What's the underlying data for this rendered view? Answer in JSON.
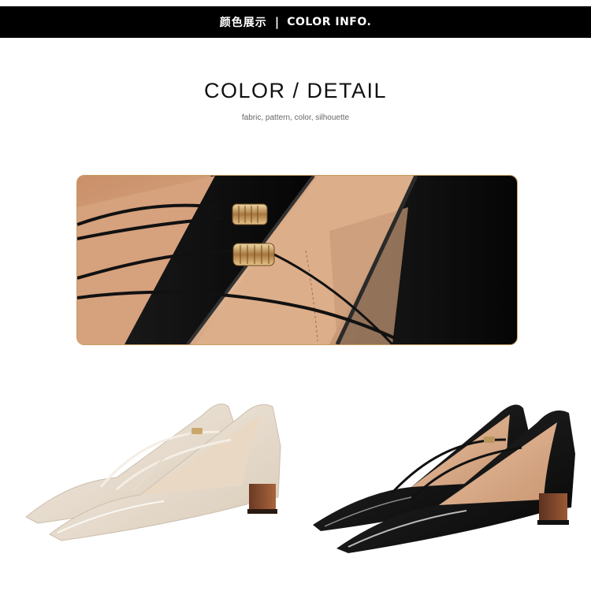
{
  "header": {
    "cn_label": "颜色展示",
    "separator": "|",
    "en_label": "COLOR INFO."
  },
  "section": {
    "title": "COLOR / DETAIL",
    "subtitle": "fabric, pattern, color, silhouette"
  },
  "colors": {
    "header_bg": "#000000",
    "frame_border": "#c89b62",
    "beige_patent": "#e8ddd0",
    "black_patent": "#0b0b0b",
    "lining": "#d9a982"
  },
  "images": [
    {
      "name": "strap-detail-closeup"
    },
    {
      "name": "beige-pump"
    },
    {
      "name": "black-pump"
    }
  ]
}
